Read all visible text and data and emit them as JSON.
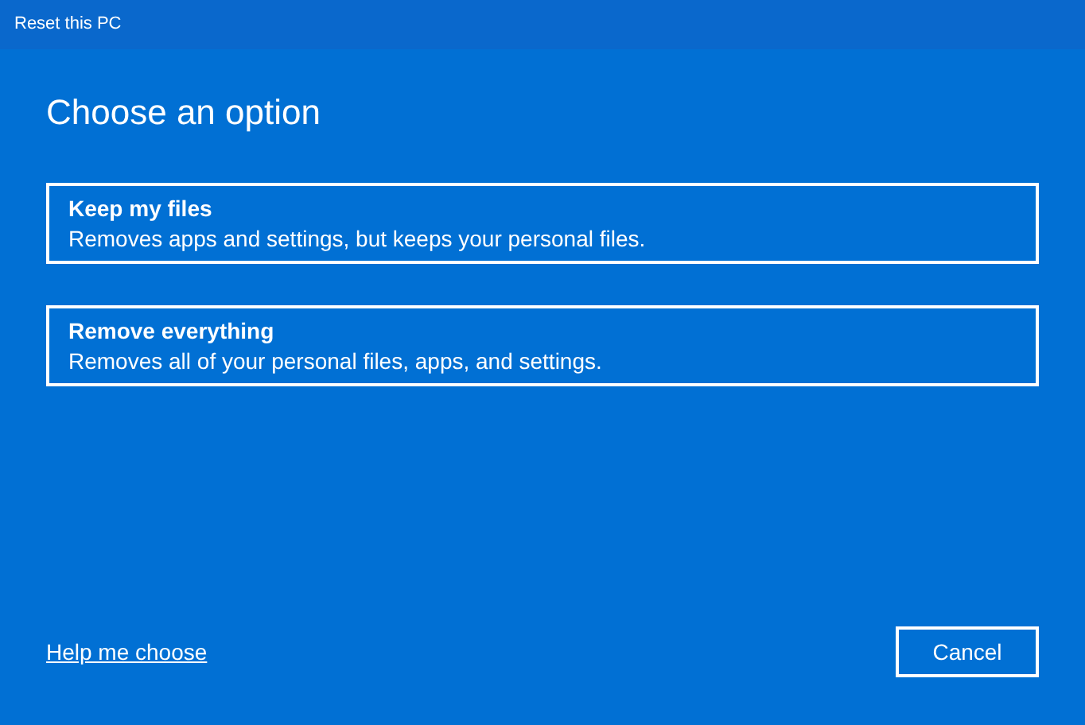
{
  "window": {
    "title": "Reset this PC"
  },
  "heading": "Choose an option",
  "options": [
    {
      "title": "Keep my files",
      "description": "Removes apps and settings, but keeps your personal files."
    },
    {
      "title": "Remove everything",
      "description": "Removes all of your personal files, apps, and settings."
    }
  ],
  "help_link": "Help me choose",
  "buttons": [
    "Cancel"
  ]
}
